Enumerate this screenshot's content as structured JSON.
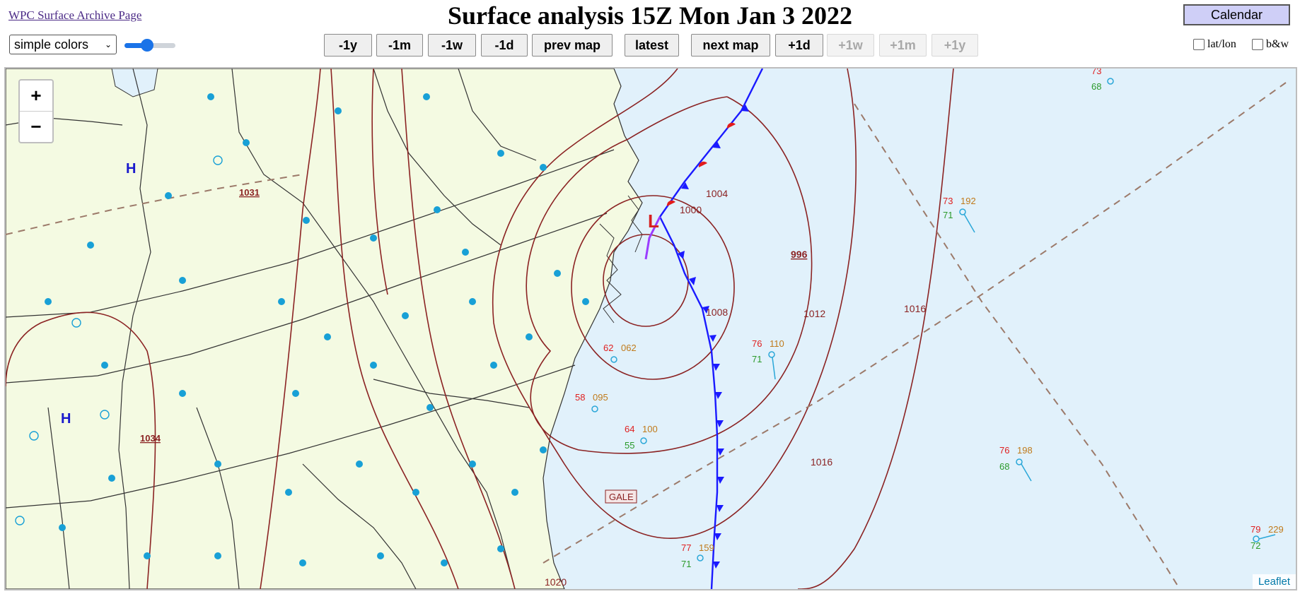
{
  "header": {
    "archive_link": "WPC Surface Archive Page",
    "title": "Surface analysis 15Z Mon Jan 3 2022",
    "calendar_label": "Calendar"
  },
  "controls": {
    "color_scheme": "simple colors",
    "opacity_fraction": 0.45,
    "nav": [
      {
        "label": "-1y",
        "enabled": true
      },
      {
        "label": "-1m",
        "enabled": true
      },
      {
        "label": "-1w",
        "enabled": true
      },
      {
        "label": "-1d",
        "enabled": true
      },
      {
        "label": "prev map",
        "enabled": true
      },
      {
        "label": "latest",
        "enabled": true
      },
      {
        "label": "next map",
        "enabled": true
      },
      {
        "label": "+1d",
        "enabled": true
      },
      {
        "label": "+1w",
        "enabled": false
      },
      {
        "label": "+1m",
        "enabled": false
      },
      {
        "label": "+1y",
        "enabled": false
      }
    ],
    "latlon_label": "lat/lon",
    "bw_label": "b&w"
  },
  "map": {
    "zoom_in": "+",
    "zoom_out": "−",
    "attribution": "Leaflet",
    "isobar_labels": [
      "1004",
      "1000",
      "1008",
      "1012",
      "1016",
      "1016",
      "1020"
    ],
    "highs": [
      {
        "symbol": "H",
        "pressure": "1031"
      },
      {
        "symbol": "H",
        "pressure": "1034"
      }
    ],
    "low": {
      "symbol": "L",
      "pressure": "996"
    },
    "gale_label": "GALE",
    "station_temps": [
      "73",
      "68",
      "73",
      "71",
      "76",
      "71",
      "76",
      "68",
      "79",
      "72",
      "77",
      "71",
      "64",
      "55",
      "62",
      "58"
    ],
    "station_pressures": [
      "192",
      "110",
      "198",
      "229",
      "159",
      "100",
      "062",
      "095"
    ],
    "colors": {
      "land": "#f4fae2",
      "ocean": "#e1f1fb",
      "isobar": "#8b2323",
      "cold_front": "#1a1aff",
      "warm_front": "#e11b1b",
      "occluded": "#9b3dff",
      "high": "#1a1acc",
      "low": "#d62020",
      "temp": "#e01f1f",
      "dewpoint": "#2a9a2a",
      "pressure": "#c07a1a",
      "wind": "#2aa7d8"
    }
  }
}
